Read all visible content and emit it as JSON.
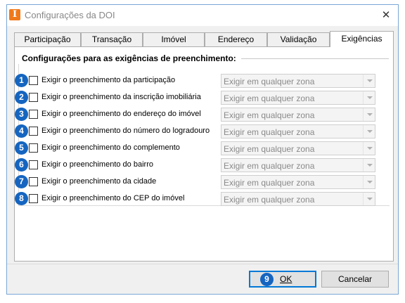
{
  "window": {
    "title": "Configurações da DOI",
    "app_icon_letter": "I",
    "close_glyph": "✕"
  },
  "tabs": [
    {
      "label": "Participação",
      "active": false
    },
    {
      "label": "Transação",
      "active": false
    },
    {
      "label": "Imóvel",
      "active": false
    },
    {
      "label": "Endereço",
      "active": false
    },
    {
      "label": "Validação",
      "active": false
    },
    {
      "label": "Exigências",
      "active": true
    }
  ],
  "section": {
    "title": "Configurações para as exigências de preenchimento:"
  },
  "rows": [
    {
      "badge": "1",
      "label": "Exigir o preenchimento da participação",
      "checked": false,
      "select_value": "Exigir em qualquer zona"
    },
    {
      "badge": "2",
      "label": "Exigir o preenchimento da inscrição imobiliária",
      "checked": false,
      "select_value": "Exigir em qualquer zona"
    },
    {
      "badge": "3",
      "label": "Exigir o preenchimento do endereço do imóvel",
      "checked": false,
      "select_value": "Exigir em qualquer zona"
    },
    {
      "badge": "4",
      "label": "Exigir o preenchimento do número do logradouro",
      "checked": false,
      "select_value": "Exigir em qualquer zona"
    },
    {
      "badge": "5",
      "label": "Exigir o preenchimento do complemento",
      "checked": false,
      "select_value": "Exigir em qualquer zona"
    },
    {
      "badge": "6",
      "label": "Exigir o preenchimento do bairro",
      "checked": false,
      "select_value": "Exigir em qualquer zona"
    },
    {
      "badge": "7",
      "label": "Exigir o preenchimento da cidade",
      "checked": false,
      "select_value": "Exigir em qualquer zona"
    },
    {
      "badge": "8",
      "label": "Exigir o preenchimento do CEP do imóvel",
      "checked": false,
      "select_value": "Exigir em qualquer zona"
    }
  ],
  "footer": {
    "ok_badge": "9",
    "ok_label": "OK",
    "cancel_label": "Cancelar"
  },
  "colors": {
    "badge": "#1565c0",
    "app_icon": "#f07a1a",
    "focus_border": "#0078d7"
  }
}
